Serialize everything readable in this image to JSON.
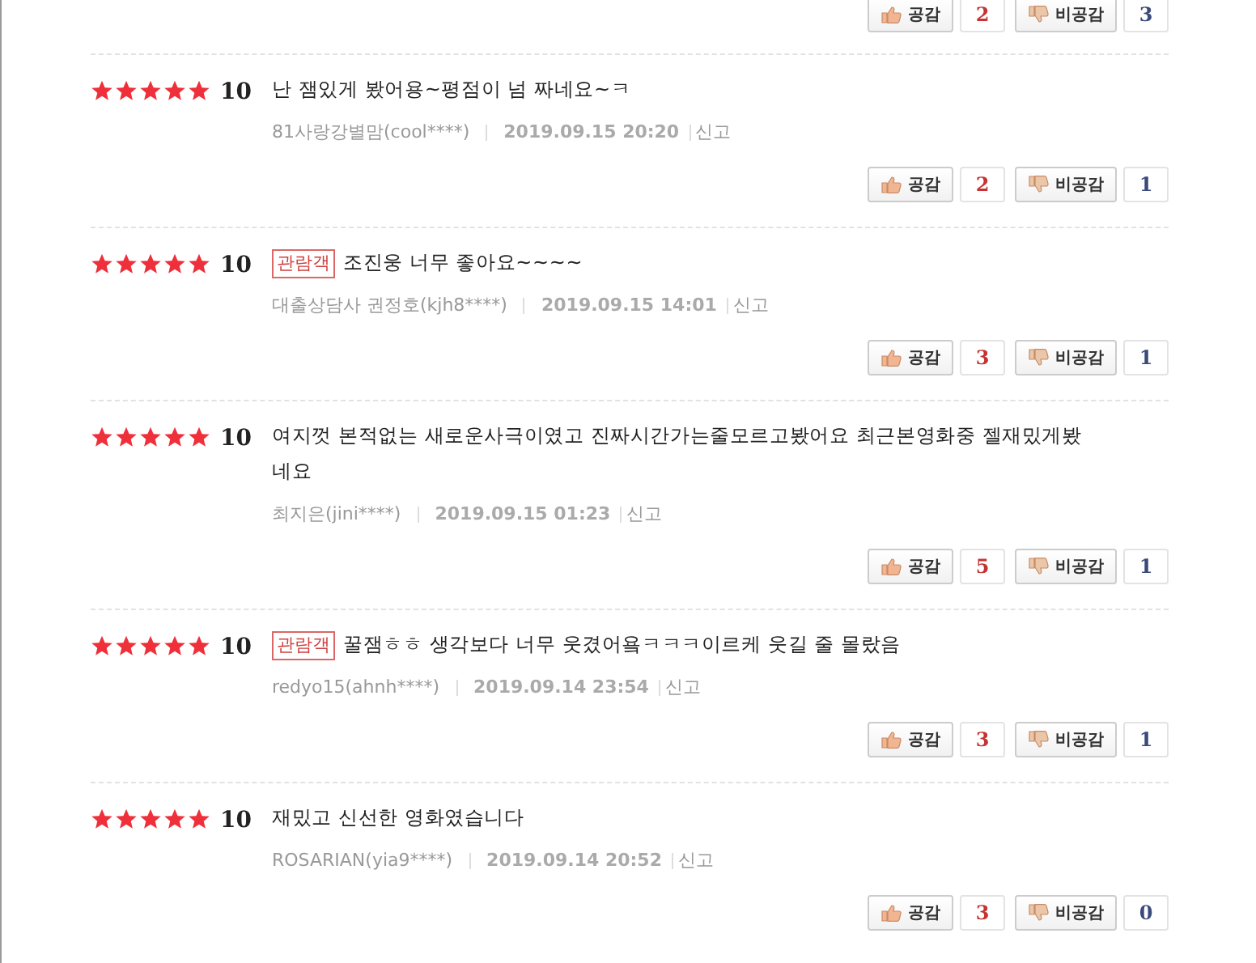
{
  "previous_votes": {
    "like_label": "공감",
    "like_count": "2",
    "dislike_label": "비공감",
    "dislike_count": "3"
  },
  "reviews": [
    {
      "stars": 5,
      "score": "10",
      "text": "난 잼있게 봤어용~평점이 넘 짜네요~ㅋ",
      "author": "81사랑강별맘(cool****)",
      "date": "2019.09.15 20:20",
      "report": "신고",
      "like_label": "공감",
      "like_count": "2",
      "dislike_label": "비공감",
      "dislike_count": "1"
    },
    {
      "stars": 5,
      "score": "10",
      "badge": "관람객",
      "text": "조진웅 너무 좋아요~~~~",
      "author": "대출상담사 권정호(kjh8****)",
      "date": "2019.09.15 14:01",
      "report": "신고",
      "like_label": "공감",
      "like_count": "3",
      "dislike_label": "비공감",
      "dislike_count": "1"
    },
    {
      "stars": 5,
      "score": "10",
      "text": "여지껏 본적없는 새로운사극이였고 진짜시간가는줄모르고봤어요 최근본영화중 젤재밌게봤네요",
      "author": "최지은(jini****)",
      "date": "2019.09.15 01:23",
      "report": "신고",
      "like_label": "공감",
      "like_count": "5",
      "dislike_label": "비공감",
      "dislike_count": "1"
    },
    {
      "stars": 5,
      "score": "10",
      "badge": "관람객",
      "text": "꿀잼ㅎㅎ 생각보다 너무 웃겼어욬ㅋㅋㅋ이르케 웃길 줄 몰랐음",
      "author": "redyo15(ahnh****)",
      "date": "2019.09.14 23:54",
      "report": "신고",
      "like_label": "공감",
      "like_count": "3",
      "dislike_label": "비공감",
      "dislike_count": "1"
    },
    {
      "stars": 5,
      "score": "10",
      "text": "재밌고 신선한 영화였습니다",
      "author": "ROSARIAN(yia9****)",
      "date": "2019.09.14 20:52",
      "report": "신고",
      "like_label": "공감",
      "like_count": "3",
      "dislike_label": "비공감",
      "dislike_count": "0"
    }
  ]
}
